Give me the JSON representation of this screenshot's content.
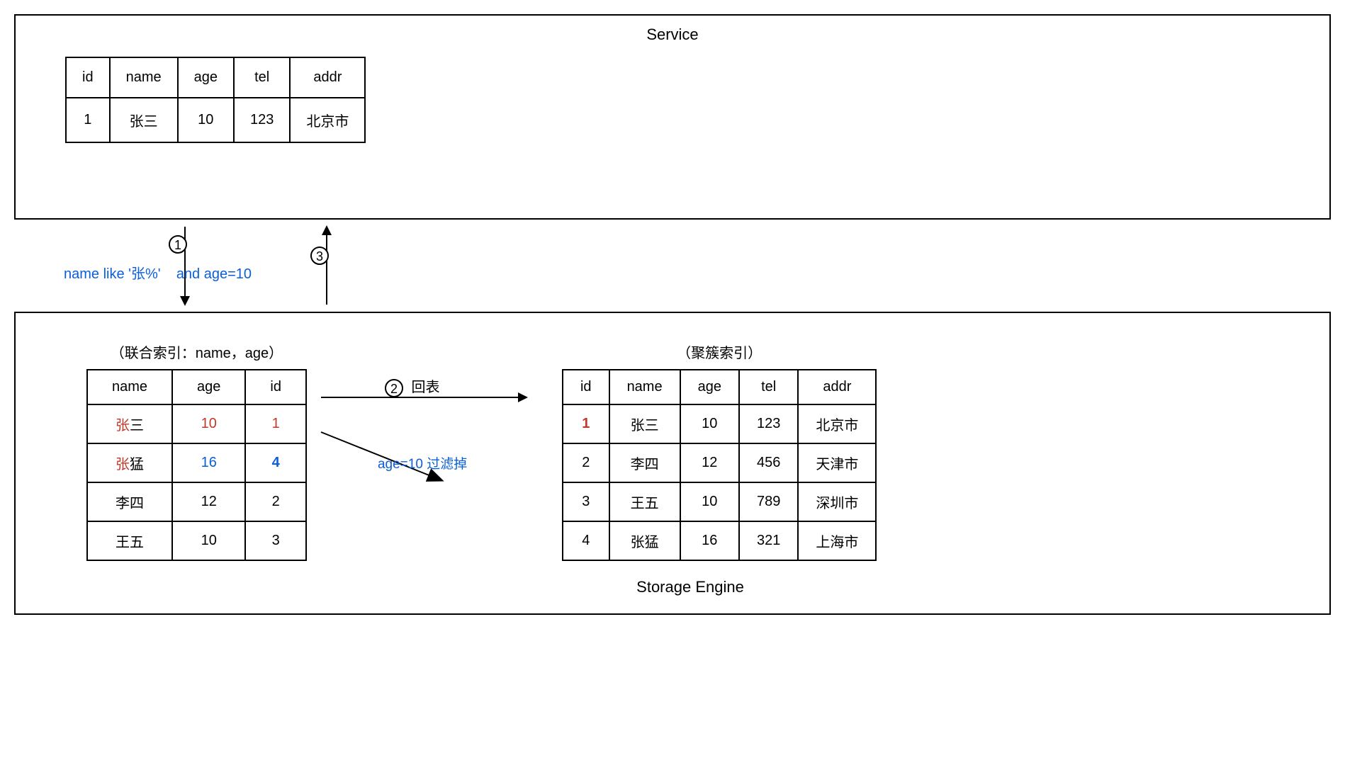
{
  "service": {
    "title": "Service",
    "table": {
      "headers": [
        "id",
        "name",
        "age",
        "tel",
        "addr"
      ],
      "row": {
        "id": "1",
        "name": "张三",
        "age": "10",
        "tel": "123",
        "addr": "北京市"
      }
    }
  },
  "arrows": {
    "step1": "1",
    "step3": "3",
    "query_part1": "name like '张%'",
    "query_part2": "and age=10",
    "step2": "2",
    "callback_label": "回表",
    "filter_label": "age=10 过滤掉"
  },
  "storage": {
    "title": "Storage Engine",
    "composite": {
      "caption": "（联合索引：name，age）",
      "headers": [
        "name",
        "age",
        "id"
      ],
      "rows": [
        {
          "name_prefix": "张",
          "name_rest": "三",
          "age": "10",
          "id": "1"
        },
        {
          "name_prefix": "张",
          "name_rest": "猛",
          "age": "16",
          "id": "4"
        },
        {
          "name_plain": "李四",
          "age": "12",
          "id": "2"
        },
        {
          "name_plain": "王五",
          "age": "10",
          "id": "3"
        }
      ]
    },
    "cluster": {
      "caption": "（聚簇索引）",
      "headers": [
        "id",
        "name",
        "age",
        "tel",
        "addr"
      ],
      "rows": [
        {
          "id": "1",
          "name": "张三",
          "age": "10",
          "tel": "123",
          "addr": "北京市"
        },
        {
          "id": "2",
          "name": "李四",
          "age": "12",
          "tel": "456",
          "addr": "天津市"
        },
        {
          "id": "3",
          "name": "王五",
          "age": "10",
          "tel": "789",
          "addr": "深圳市"
        },
        {
          "id": "4",
          "name": "张猛",
          "age": "16",
          "tel": "321",
          "addr": "上海市"
        }
      ]
    }
  }
}
